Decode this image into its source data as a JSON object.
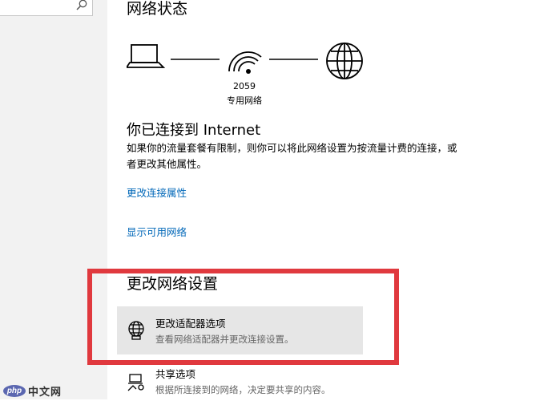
{
  "status_section": {
    "title": "网络状态",
    "network_ssid": "2059",
    "network_type": "专用网络"
  },
  "connection": {
    "title": "你已连接到 Internet",
    "description": "如果你的流量套餐有限制，则你可以将此网络设置为按流量计费的连接，或者更改其他属性。",
    "change_properties_link": "更改连接属性",
    "show_networks_link": "显示可用网络"
  },
  "change_settings": {
    "title": "更改网络设置",
    "options": [
      {
        "title": "更改适配器选项",
        "subtitle": "查看网络适配器并更改连接设置。",
        "icon": "adapter-globe-icon"
      },
      {
        "title": "共享选项",
        "subtitle": "根据所连接到的网络，决定要共享的内容。",
        "icon": "sharing-icon"
      }
    ]
  },
  "watermark": {
    "logo": "php",
    "text": "中文网"
  },
  "colors": {
    "link": "#0067b8",
    "highlight": "#e0393e",
    "selected_bg": "#e6e6e6",
    "sidebar_bg": "#f2f2f2"
  }
}
